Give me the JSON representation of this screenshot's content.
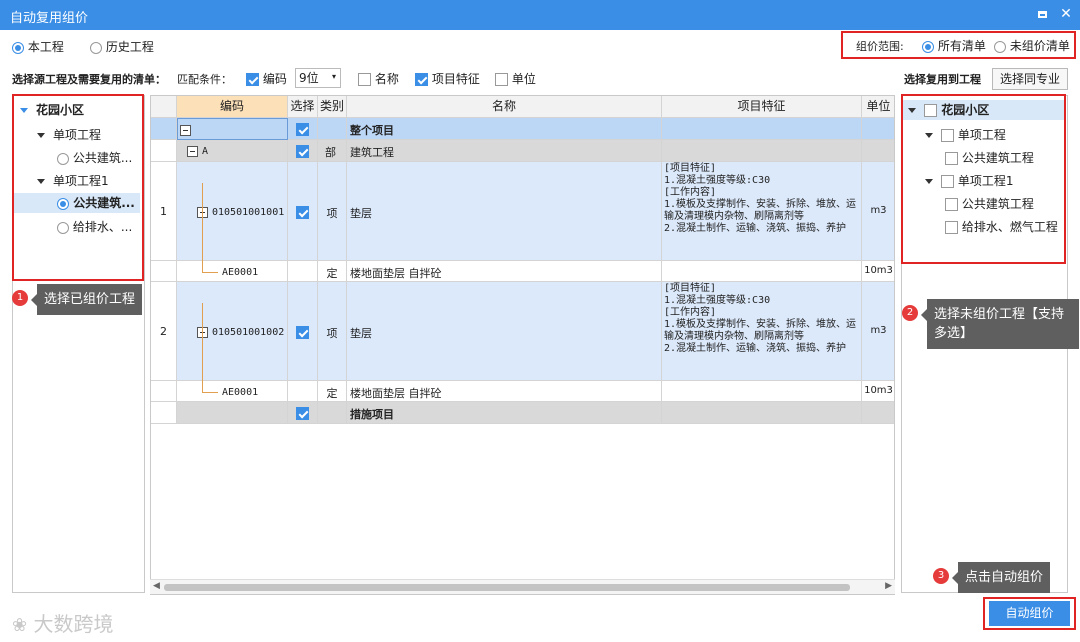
{
  "window": {
    "title": "自动复用组价"
  },
  "scope_tabs": [
    {
      "label": "本工程",
      "selected": true
    },
    {
      "label": "历史工程",
      "selected": false
    }
  ],
  "price_scope": {
    "label": "组价范围:",
    "options": [
      {
        "label": "所有清单",
        "selected": true
      },
      {
        "label": "未组价清单",
        "selected": false
      }
    ]
  },
  "filter": {
    "section_label": "选择源工程及需要复用的清单：",
    "match_label": "匹配条件：",
    "code_check": {
      "label": "编码",
      "checked": true
    },
    "digits_value": "9位",
    "name_check": {
      "label": "名称",
      "checked": false
    },
    "feature_check": {
      "label": "项目特征",
      "checked": true
    },
    "unit_check": {
      "label": "单位",
      "checked": false
    }
  },
  "target": {
    "label": "选择复用到工程",
    "same_major_button": "选择同专业"
  },
  "left_tree": [
    {
      "label": "花园小区",
      "bold": true
    },
    {
      "label": "单项工程"
    },
    {
      "label": "公共建筑...",
      "radio": true,
      "selected": false
    },
    {
      "label": "单项工程1"
    },
    {
      "label": "公共建筑...",
      "radio": true,
      "selected": true
    },
    {
      "label": "给排水、...",
      "radio": true,
      "selected": false
    }
  ],
  "right_tree": [
    {
      "label": "花园小区",
      "bold": true
    },
    {
      "label": "单项工程"
    },
    {
      "label": "公共建筑工程"
    },
    {
      "label": "单项工程1"
    },
    {
      "label": "公共建筑工程"
    },
    {
      "label": "给排水、燃气工程"
    }
  ],
  "grid": {
    "headers": [
      "编码",
      "选择",
      "类别",
      "名称",
      "项目特征",
      "单位"
    ],
    "rows": [
      {
        "num": "",
        "code": "",
        "checked": true,
        "type": "",
        "name": "整个项目",
        "feature": "",
        "unit": ""
      },
      {
        "num": "",
        "code": "A",
        "checked": true,
        "type": "部",
        "name": "建筑工程",
        "feature": "",
        "unit": ""
      },
      {
        "num": "1",
        "code": "010501001001",
        "checked": true,
        "type": "项",
        "name": "垫层",
        "feature": "[项目特征]\n1.混凝土强度等级:C30\n[工作内容]\n1.模板及支撑制作、安装、拆除、堆放、运输及清理模内杂物、刷隔离剂等\n2.混凝土制作、运输、浇筑、振捣、养护",
        "unit": "m3"
      },
      {
        "num": "",
        "code": "AE0001",
        "checked": false,
        "type": "定",
        "name": "楼地面垫层 自拌砼",
        "feature": "",
        "unit": "10m3"
      },
      {
        "num": "2",
        "code": "010501001002",
        "checked": true,
        "type": "项",
        "name": "垫层",
        "feature": "[项目特征]\n1.混凝土强度等级:C30\n[工作内容]\n1.模板及支撑制作、安装、拆除、堆放、运输及清理模内杂物、刷隔离剂等\n2.混凝土制作、运输、浇筑、振捣、养护",
        "unit": "m3"
      },
      {
        "num": "",
        "code": "AE0001",
        "checked": false,
        "type": "定",
        "name": "楼地面垫层 自拌砼",
        "feature": "",
        "unit": "10m3"
      },
      {
        "num": "",
        "code": "",
        "checked": true,
        "type": "",
        "name": "措施项目",
        "feature": "",
        "unit": ""
      }
    ]
  },
  "callouts": {
    "c1": {
      "num": "1",
      "text": "选择已组价工程"
    },
    "c2": {
      "num": "2",
      "text": "选择未组价工程【支持多选】"
    },
    "c3": {
      "num": "3",
      "text": "点击自动组价"
    }
  },
  "auto_price_button": "自动组价",
  "watermark": "大数跨境",
  "colors": {
    "accent": "#3a8ee6",
    "highlight": "#e02424"
  }
}
